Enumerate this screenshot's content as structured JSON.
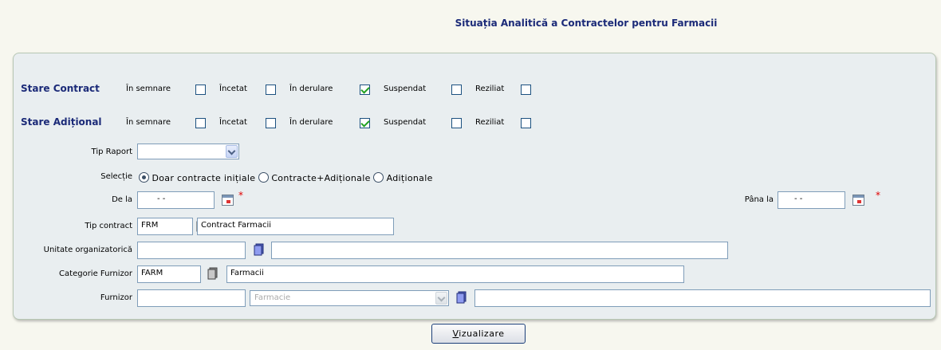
{
  "title": "Situația Analitică a Contractelor pentru Farmacii",
  "stare_contract": {
    "label": "Stare Contract",
    "options": [
      {
        "label": "În semnare",
        "checked": false
      },
      {
        "label": "Încetat",
        "checked": false
      },
      {
        "label": "În derulare",
        "checked": true
      },
      {
        "label": "Suspendat",
        "checked": false
      },
      {
        "label": "Reziliat",
        "checked": false
      }
    ]
  },
  "stare_aditional": {
    "label": "Stare Adițional",
    "options": [
      {
        "label": "În semnare",
        "checked": false
      },
      {
        "label": "Încetat",
        "checked": false
      },
      {
        "label": "În derulare",
        "checked": true
      },
      {
        "label": "Suspendat",
        "checked": false
      },
      {
        "label": "Reziliat",
        "checked": false
      }
    ]
  },
  "tip_raport": {
    "label": "Tip Raport",
    "value": ""
  },
  "selectie": {
    "label": "Selecție",
    "options": [
      {
        "label": "Doar contracte inițiale",
        "selected": true
      },
      {
        "label": "Contracte+Adiționale",
        "selected": false
      },
      {
        "label": "Adiționale",
        "selected": false
      }
    ]
  },
  "de_la": {
    "label": "De la",
    "value": "-  -",
    "required": "*"
  },
  "pana_la": {
    "label": "Pâna la",
    "value": "-  -",
    "required": "*"
  },
  "tip_contract": {
    "label": "Tip contract",
    "code": "FRM",
    "name": "Contract Farmacii"
  },
  "unitate": {
    "label": "Unitate organizatorică",
    "code": "",
    "name": ""
  },
  "categorie": {
    "label": "Categorie Furnizor",
    "code": "FARM",
    "name": "Farmacii"
  },
  "furnizor": {
    "label": "Furnizor",
    "code": "",
    "type_value": "Farmacie",
    "name": ""
  },
  "submit": {
    "prefix": "",
    "underlined": "V",
    "rest": "izualizare"
  },
  "colors": {
    "title": "#1b2a78",
    "panel_bg": "#e9eef0",
    "page_bg": "#f7f7ef",
    "check": "#21a121",
    "required": "#e00000"
  }
}
